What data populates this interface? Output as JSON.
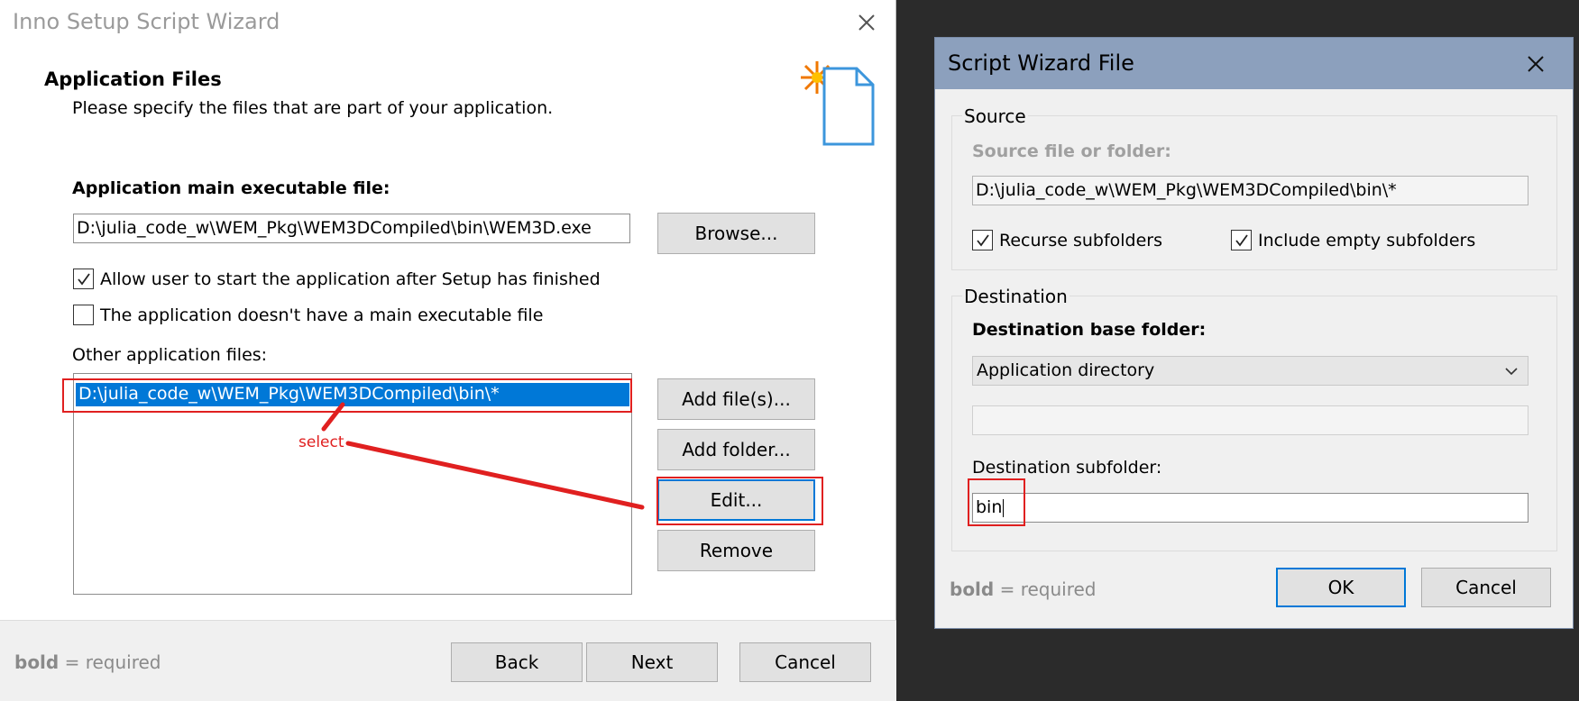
{
  "wizard": {
    "title": "Inno Setup Script Wizard",
    "heading": "Application Files",
    "description": "Please specify the files that are part of your application.",
    "main_exe_label": "Application main executable file:",
    "main_exe_value": "D:\\julia_code_w\\WEM_Pkg\\WEM3DCompiled\\bin\\WEM3D.exe",
    "browse_label": "Browse...",
    "allow_start_label": "Allow user to start the application after Setup has finished",
    "allow_start_checked": true,
    "no_main_exe_label": "The application doesn't have a main executable file",
    "no_main_exe_checked": false,
    "other_files_label": "Other application files:",
    "other_files": [
      "D:\\julia_code_w\\WEM_Pkg\\WEM3DCompiled\\bin\\*"
    ],
    "add_files_label": "Add file(s)...",
    "add_folder_label": "Add folder...",
    "edit_label": "Edit...",
    "remove_label": "Remove",
    "footer": {
      "required_bold": "bold",
      "required_rest": " = required",
      "back_label": "Back",
      "next_label": "Next",
      "cancel_label": "Cancel"
    }
  },
  "annotation": {
    "select_text": "select",
    "color": "#e02020"
  },
  "script_wizard_file": {
    "title": "Script Wizard File",
    "source_group": "Source",
    "source_label": "Source file or folder:",
    "source_value": "D:\\julia_code_w\\WEM_Pkg\\WEM3DCompiled\\bin\\*",
    "recurse_label": "Recurse subfolders",
    "recurse_checked": true,
    "include_empty_label": "Include empty subfolders",
    "include_empty_checked": true,
    "destination_group": "Destination",
    "dest_base_label": "Destination base folder:",
    "dest_base_value": "Application directory",
    "dest_subfolder_label": "Destination subfolder:",
    "dest_subfolder_value": "bin",
    "required_bold": "bold",
    "required_rest": " = required",
    "ok_label": "OK",
    "cancel_label": "Cancel"
  },
  "colors": {
    "selection": "#0078d7",
    "titlebar": "#8ca0bd",
    "annotation": "#e02020"
  }
}
